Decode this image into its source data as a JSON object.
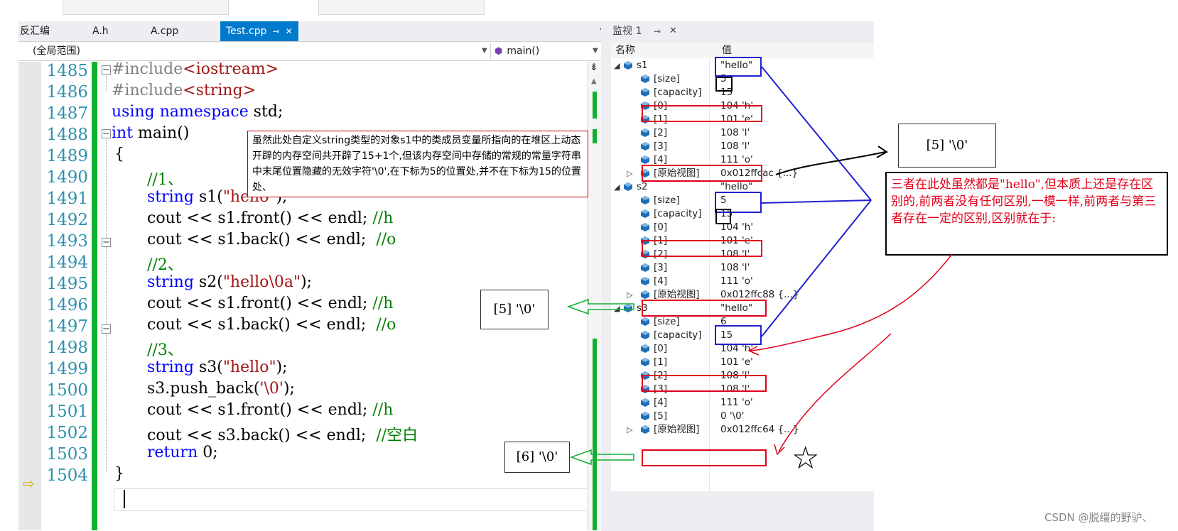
{
  "tabs": [
    {
      "label": "反汇编"
    },
    {
      "label": "A.h"
    },
    {
      "label": "A.cpp"
    },
    {
      "label": "Test.cpp",
      "active": true
    }
  ],
  "scope": {
    "left": "(全局范围)",
    "right": "main()"
  },
  "lines": [
    {
      "num": "1485"
    },
    {
      "num": "1486"
    },
    {
      "num": "1487"
    },
    {
      "num": "1488"
    },
    {
      "num": "1489"
    },
    {
      "num": "1490"
    },
    {
      "num": "1491"
    },
    {
      "num": "1492"
    },
    {
      "num": "1493"
    },
    {
      "num": "1494"
    },
    {
      "num": "1495"
    },
    {
      "num": "1496"
    },
    {
      "num": "1497"
    },
    {
      "num": "1498"
    },
    {
      "num": "1499"
    },
    {
      "num": "1500"
    },
    {
      "num": "1501"
    },
    {
      "num": "1502"
    },
    {
      "num": "1503"
    },
    {
      "num": "1504"
    }
  ],
  "code": {
    "l1485": {
      "pp": "#include",
      "inc": "<iostream>"
    },
    "l1486": {
      "pp": "#include",
      "inc": "<string>"
    },
    "l1487": {
      "kw1": "using",
      "kw2": "namespace",
      "rest": "std;"
    },
    "l1488": {
      "kw": "int",
      "rest": "main()"
    },
    "l1489": {
      "text": "{"
    },
    "l1490": {
      "cm": "//1、"
    },
    "l1491": {
      "kw": "string",
      "a": "s1(",
      "str": "\"hello\"",
      "b": ");"
    },
    "l1492": {
      "code": "cout << s1.front() << endl;",
      "cm": "//h"
    },
    "l1493": {
      "code": "cout << s1.back() << endl;",
      "cm": "//o"
    },
    "l1494": {
      "cm": "//2、"
    },
    "l1495": {
      "kw": "string",
      "a": "s2(",
      "str": "\"hello\\0a\"",
      "b": ");"
    },
    "l1496": {
      "code": "cout << s1.front() << endl;",
      "cm": "//h"
    },
    "l1497": {
      "code": "cout << s1.back() << endl;",
      "cm": "//o"
    },
    "l1498": {
      "cm": "//3、"
    },
    "l1499": {
      "kw": "string",
      "a": "s3(",
      "str": "\"hello\"",
      "b": ");"
    },
    "l1500": {
      "a": "s3.push_back(",
      "str": "'\\0'",
      "b": ");"
    },
    "l1501": {
      "code": "cout << s1.front() << endl;",
      "cm": "//h"
    },
    "l1502": {
      "code": "cout << s3.back() << endl;",
      "cm": "//空白"
    },
    "l1503": {
      "kw": "return",
      "rest": "0;"
    },
    "l1504": {
      "text": "}"
    }
  },
  "annotation_note": "虽然此处自定义string类型的对象s1中的类成员变量所指向的在堆区上动态开辟的内存空间共开辟了15+1个,但该内存空间中存储的常规的常量字符串中末尾位置隐藏的无效字符'\\0',在下标为5的位置处,并不在下标为15的位置处、",
  "callout_s2": "[5] '\\0'",
  "callout_s3": "[6] '\\0'",
  "callout_s1": "[5] '\\0'",
  "watch": {
    "title": "监视 1",
    "col_name": "名称",
    "col_value": "值",
    "rows": [
      {
        "name": "s1",
        "value": "\"hello\""
      },
      {
        "name": "[size]",
        "value": "5"
      },
      {
        "name": "[capacity]",
        "value": "15"
      },
      {
        "name": "[0]",
        "value": "104 'h'"
      },
      {
        "name": "[1]",
        "value": "101 'e'"
      },
      {
        "name": "[2]",
        "value": "108 'l'"
      },
      {
        "name": "[3]",
        "value": "108 'l'"
      },
      {
        "name": "[4]",
        "value": "111 'o'"
      },
      {
        "name": "[原始视图]",
        "value": "0x012ffcac {...}"
      },
      {
        "name": "s2",
        "value": "\"hello\""
      },
      {
        "name": "[size]",
        "value": "5"
      },
      {
        "name": "[capacity]",
        "value": "15"
      },
      {
        "name": "[0]",
        "value": "104 'h'"
      },
      {
        "name": "[1]",
        "value": "101 'e'"
      },
      {
        "name": "[2]",
        "value": "108 'l'"
      },
      {
        "name": "[3]",
        "value": "108 'l'"
      },
      {
        "name": "[4]",
        "value": "111 'o'"
      },
      {
        "name": "[原始视图]",
        "value": "0x012ffc88 {...}"
      },
      {
        "name": "s3",
        "value": "\"hello\""
      },
      {
        "name": "[size]",
        "value": "6"
      },
      {
        "name": "[capacity]",
        "value": "15"
      },
      {
        "name": "[0]",
        "value": "104 'h'"
      },
      {
        "name": "[1]",
        "value": "101 'e'"
      },
      {
        "name": "[2]",
        "value": "108 'l'"
      },
      {
        "name": "[3]",
        "value": "108 'l'"
      },
      {
        "name": "[4]",
        "value": "111 'o'"
      },
      {
        "name": "[5]",
        "value": "0 '\\0'"
      },
      {
        "name": "[原始视图]",
        "value": "0x012ffc64 {...}"
      }
    ]
  },
  "big_note": "三者在此处虽然都是\"hello\",但本质上还是存在区别的,前两者没有任何区别,一模一样,前两者与第三者存在一定的区别,区别就在于:",
  "star": "☆",
  "watermark": "CSDN @脱缰的野驴、",
  "icons": {
    "current_line": "arrow-right-icon",
    "variable": "cube-icon",
    "function": "cube-purple-icon"
  },
  "colors": {
    "accent": "#007acc",
    "change_bar": "#10b030",
    "red_mark": "#e0001a",
    "blue_mark": "#2020d0"
  }
}
